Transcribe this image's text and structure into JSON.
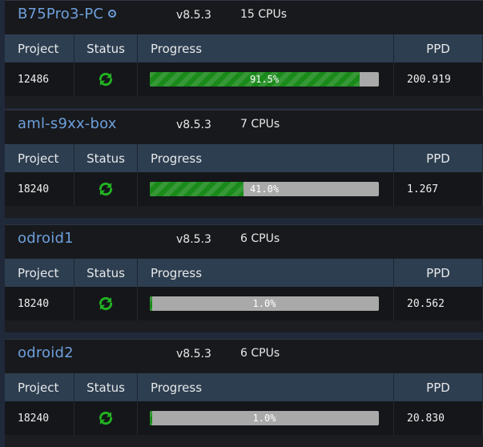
{
  "colors": {
    "host_name": "#6d9fdc",
    "progress_fill": "#1a8a1a",
    "progress_track": "#a9a9a9",
    "status_ok": "#22b322",
    "table_header": "#2d3e50"
  },
  "columns": {
    "project": "Project",
    "status": "Status",
    "progress": "Progress",
    "ppd": "PPD"
  },
  "machines": [
    {
      "name": "B75Pro3-PC",
      "has_target_icon": true,
      "version": "v8.5.3",
      "cpus": "15 CPUs",
      "project": "12486",
      "status_icon": "refresh-icon",
      "progress_text": "91.5%",
      "progress_fraction": 0.915,
      "ppd": "200.919"
    },
    {
      "name": "aml-s9xx-box",
      "has_target_icon": false,
      "version": "v8.5.3",
      "cpus": "7 CPUs",
      "project": "18240",
      "status_icon": "refresh-icon",
      "progress_text": "41.0%",
      "progress_fraction": 0.41,
      "ppd": "1.267"
    },
    {
      "name": "odroid1",
      "has_target_icon": false,
      "version": "v8.5.3",
      "cpus": "6 CPUs",
      "project": "18240",
      "status_icon": "refresh-icon",
      "progress_text": "1.0%",
      "progress_fraction": 0.01,
      "ppd": "20.562"
    },
    {
      "name": "odroid2",
      "has_target_icon": false,
      "version": "v8.5.3",
      "cpus": "6 CPUs",
      "project": "18240",
      "status_icon": "refresh-icon",
      "progress_text": "1.0%",
      "progress_fraction": 0.01,
      "ppd": "20.830"
    }
  ]
}
